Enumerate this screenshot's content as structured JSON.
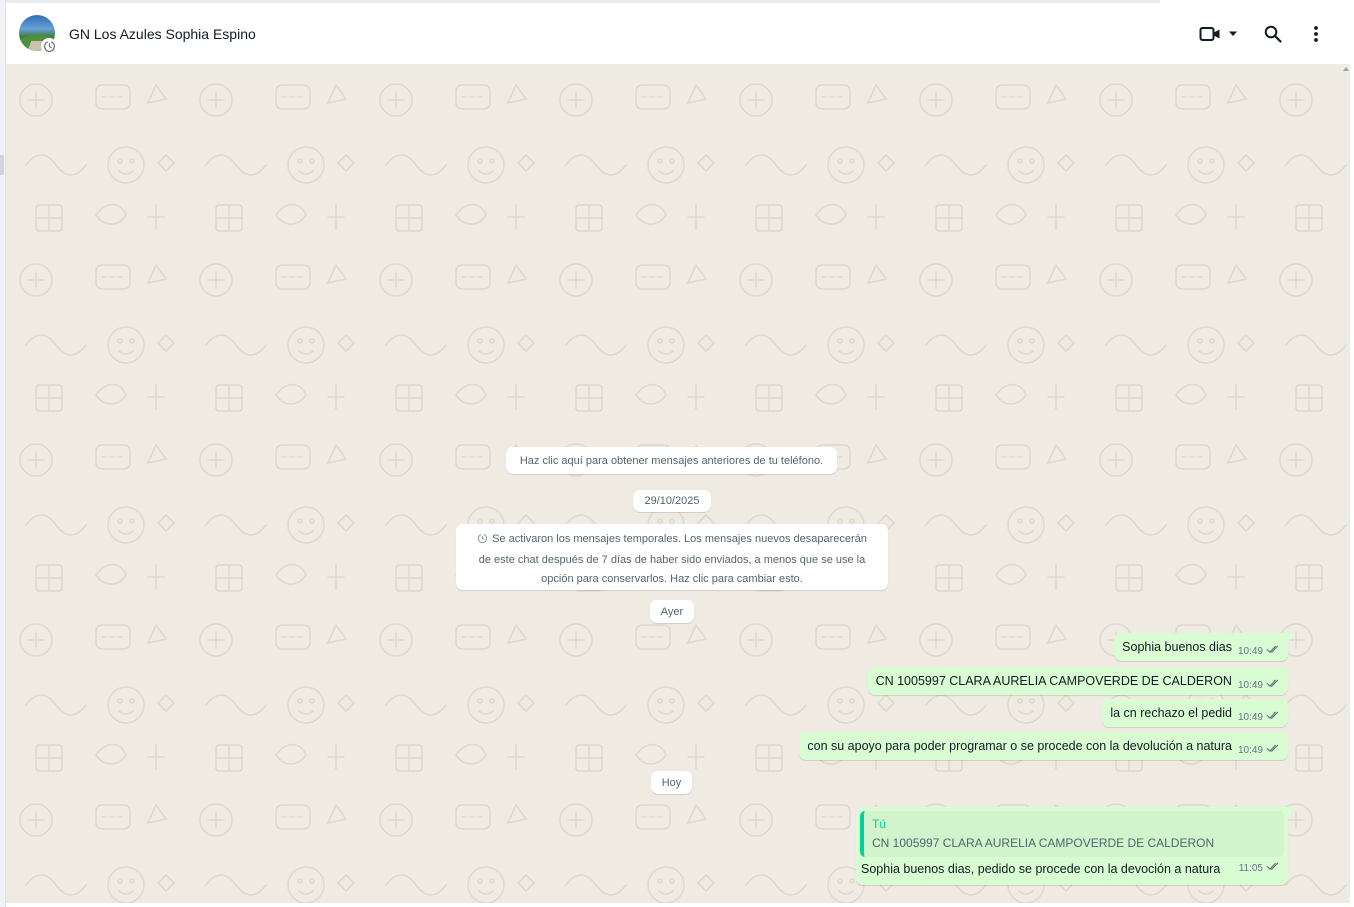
{
  "header": {
    "title": "GN Los Azules Sophia Espino",
    "avatar_icon": "group-avatar-photo",
    "disappearing_badge_icon": "timer-icon",
    "video_call_icon": "video-camera-icon",
    "dropdown_icon": "chevron-down-icon",
    "search_icon": "search-icon",
    "menu_icon": "more-vertical-icon"
  },
  "chat": {
    "background_color": "#efeae2",
    "outgoing_bubble_color": "#d9fdd3",
    "accent_color": "#06cf9c",
    "load_older": "Haz clic aquí para obtener mensajes anteriores de tu teléfono.",
    "date_1": "29/10/2025",
    "notice_line_1": "Se activaron los mensajes temporales. Los mensajes nuevos desaparecerán",
    "notice_line_2": "de este chat después de 7 días de haber sido enviados, a menos que se use la",
    "notice_line_3": "opción para conservarlos. Haz clic para cambiar esto.",
    "date_2": "Ayer",
    "messages": [
      {
        "text": "Sophia buenos dias",
        "time": "10:49",
        "status": "sent-double-check"
      },
      {
        "text": "CN 1005997 CLARA AURELIA CAMPOVERDE DE CALDERON",
        "time": "10:49",
        "status": "sent-double-check"
      },
      {
        "text": "la cn rechazo el pedid",
        "time": "10:49",
        "status": "sent-double-check"
      },
      {
        "text": "con su apoyo para poder programar o se procede con la devolución a natura",
        "time": "10:49",
        "status": "sent-double-check"
      }
    ],
    "date_3": "Hoy",
    "reply": {
      "quoted_author": "Tú",
      "quoted_text": "CN 1005997 CLARA AURELIA CAMPOVERDE DE CALDERON",
      "text": "Sophia buenos dias, pedido se procede con la devoción a natura",
      "time": "11:05",
      "status": "sent-double-check"
    }
  }
}
